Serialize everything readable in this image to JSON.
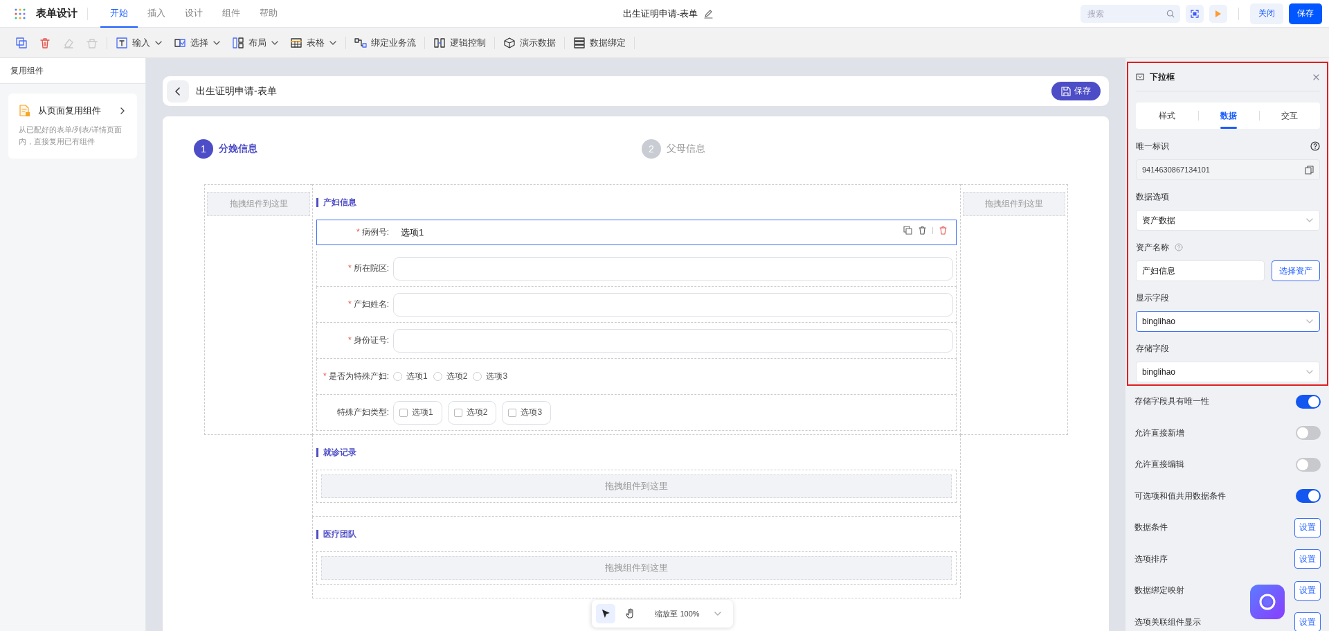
{
  "app": {
    "title": "表单设计",
    "menu": [
      {
        "label": "开始",
        "selected": true
      },
      {
        "label": "插入",
        "selected": false
      },
      {
        "label": "设计",
        "selected": false
      },
      {
        "label": "组件",
        "selected": false
      },
      {
        "label": "帮助",
        "selected": false
      }
    ],
    "document_title": "出生证明申请-表单",
    "search": {
      "placeholder": "搜索"
    },
    "close_button": "关闭",
    "save_button": "保存"
  },
  "toolbar": [
    {
      "kind": "icon",
      "disabled": false
    },
    {
      "kind": "icon",
      "disabled": false
    },
    {
      "kind": "icon",
      "disabled": true
    },
    {
      "kind": "icon",
      "disabled": true
    },
    {
      "kind": "dropdown",
      "label": "输入"
    },
    {
      "kind": "dropdown",
      "label": "选择"
    },
    {
      "kind": "dropdown",
      "label": "布局"
    },
    {
      "kind": "dropdown",
      "label": "表格"
    },
    {
      "kind": "action",
      "label": "绑定业务流"
    },
    {
      "kind": "action",
      "label": "逻辑控制"
    },
    {
      "kind": "action",
      "label": "演示数据"
    },
    {
      "kind": "action",
      "label": "数据绑定"
    }
  ],
  "left_panel": {
    "title": "复用组件",
    "card": {
      "title": "从页面复用组件",
      "description": "从已配好的表单/列表/详情页面内，直接复用已有组件"
    }
  },
  "canvas": {
    "title": "出生证明申请-表单",
    "save_button": "保存",
    "required_mark": "*",
    "steps": [
      {
        "number": "1",
        "label": "分娩信息",
        "selected": true
      },
      {
        "number": "2",
        "label": "父母信息",
        "selected": false
      }
    ],
    "side_dropzones": [
      "拖拽组件到这里",
      "拖拽组件到这里"
    ],
    "sections": [
      {
        "title": "产妇信息",
        "fields": [
          {
            "kind": "input",
            "label": "病例号:",
            "required": true,
            "value": "选项1",
            "selected": true
          },
          {
            "kind": "input",
            "label": "所在院区:",
            "required": true,
            "selected": false
          },
          {
            "kind": "input",
            "label": "产妇姓名:",
            "required": true,
            "selected": false
          },
          {
            "kind": "input",
            "label": "身份证号:",
            "required": true,
            "selected": false
          },
          {
            "kind": "radio",
            "label": "是否为特殊产妇:",
            "required": true,
            "selected": false,
            "options": [
              {
                "label": "选项1",
                "checked": false
              },
              {
                "label": "选项2",
                "checked": false
              },
              {
                "label": "选项3",
                "checked": false
              }
            ]
          },
          {
            "kind": "checkbox",
            "label": "特殊产妇类型:",
            "required": false,
            "selected": false,
            "options": [
              {
                "label": "选项1",
                "checked": false
              },
              {
                "label": "选项2",
                "checked": false
              },
              {
                "label": "选项3",
                "checked": false
              }
            ]
          }
        ]
      },
      {
        "title": "就诊记录",
        "dropzone": "拖拽组件到这里"
      },
      {
        "title": "医疗团队",
        "dropzone": "拖拽组件到这里"
      }
    ],
    "zoom_bar": {
      "tools": [
        {
          "selected": true
        },
        {
          "selected": false
        }
      ],
      "zoom": "缩放至 100%"
    }
  },
  "properties": {
    "title": "下拉框",
    "tabs": [
      {
        "label": "样式",
        "selected": false
      },
      {
        "label": "数据",
        "selected": true
      },
      {
        "label": "交互",
        "selected": false
      }
    ],
    "fields": [
      {
        "kind": "readonly",
        "label": "唯一标识",
        "value": "9414630867134101"
      },
      {
        "kind": "select",
        "label": "数据选项",
        "value": "资产数据",
        "focused": false
      },
      {
        "kind": "input-button",
        "label": "资产名称",
        "value": "产妇信息",
        "button": "选择资产"
      },
      {
        "kind": "select",
        "label": "显示字段",
        "value": "binglihao",
        "focused": true
      },
      {
        "kind": "select",
        "label": "存储字段",
        "value": "binglihao",
        "focused": false
      }
    ],
    "options": [
      {
        "kind": "toggle",
        "label": "存储字段具有唯一性",
        "on": true
      },
      {
        "kind": "toggle",
        "label": "允许直接新增",
        "on": false
      },
      {
        "kind": "toggle",
        "label": "允许直接编辑",
        "on": false
      },
      {
        "kind": "toggle",
        "label": "可选项和值共用数据条件",
        "on": true
      },
      {
        "kind": "button",
        "label": "数据条件",
        "button": "设置"
      },
      {
        "kind": "button",
        "label": "选项排序",
        "button": "设置"
      },
      {
        "kind": "button",
        "label": "数据绑定映射",
        "button": "设置"
      },
      {
        "kind": "button",
        "label": "选项关联组件显示",
        "button": "设置"
      }
    ]
  }
}
